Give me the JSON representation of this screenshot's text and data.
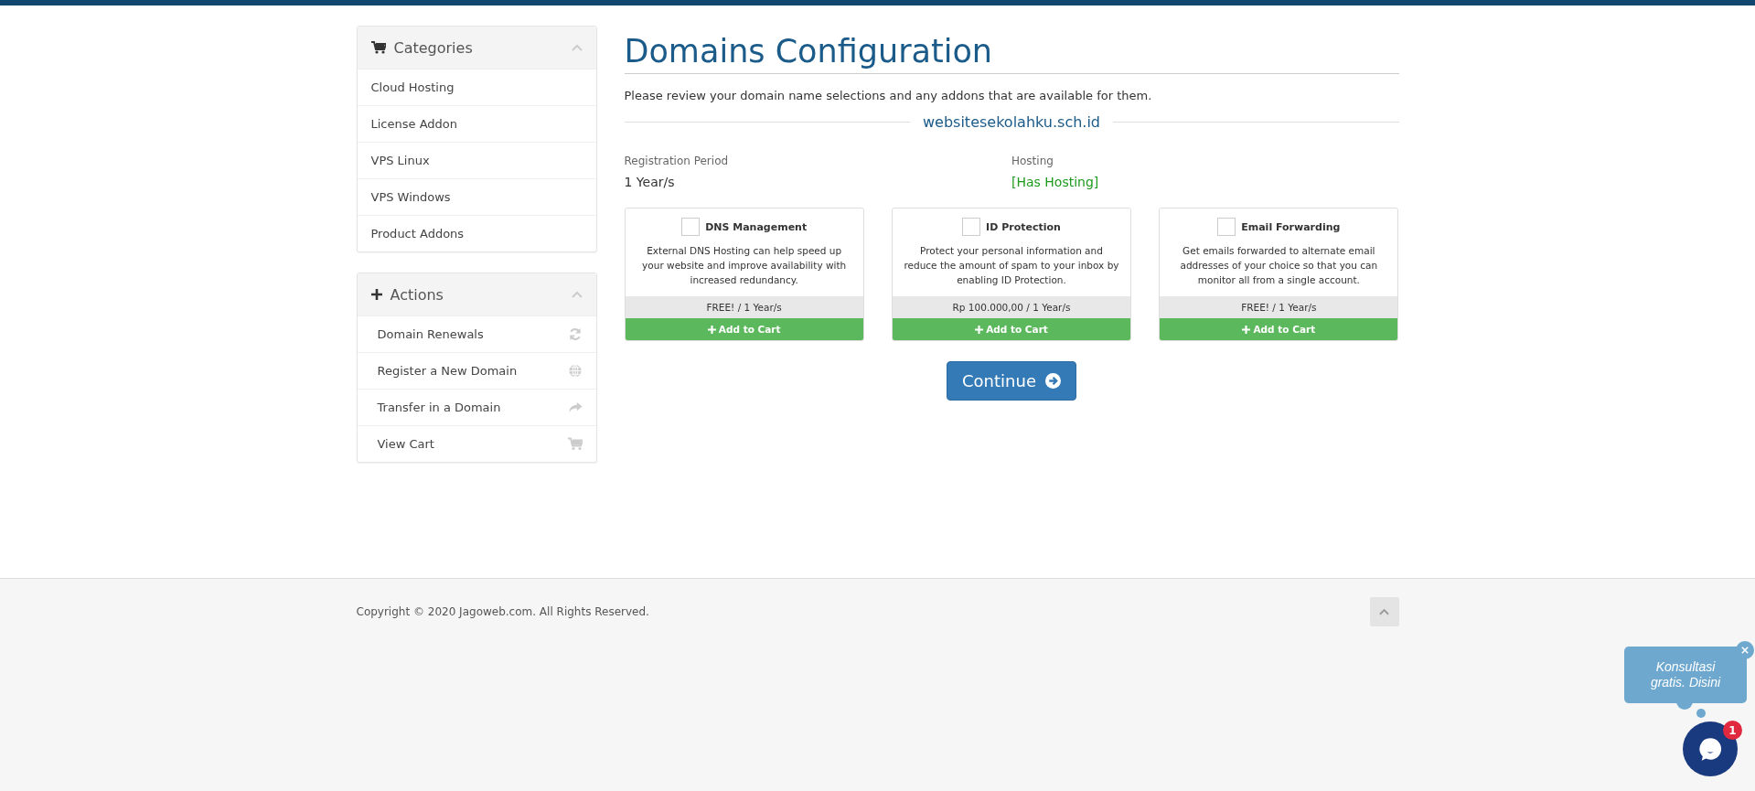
{
  "sidebar": {
    "categories": {
      "title": "Categories",
      "expanded": true,
      "items": [
        {
          "label": "Cloud Hosting"
        },
        {
          "label": "License Addon"
        },
        {
          "label": "VPS Linux"
        },
        {
          "label": "VPS Windows"
        },
        {
          "label": "Product Addons"
        }
      ]
    },
    "actions": {
      "title": "Actions",
      "expanded": true,
      "items": [
        {
          "label": "Domain Renewals",
          "kind": "refresh"
        },
        {
          "label": "Register a New Domain",
          "kind": "globe"
        },
        {
          "label": "Transfer in a Domain",
          "kind": "share"
        },
        {
          "label": "View Cart",
          "kind": "cart"
        }
      ]
    }
  },
  "main": {
    "title": "Domains Configuration",
    "intro": "Please review your domain name selections and any addons that are available for them.",
    "domain": "websitesekolahku.sch.id",
    "fields": [
      {
        "label": "Registration Period",
        "value": "1 Year/s",
        "kind": "plain"
      },
      {
        "label": "Hosting",
        "value": "[Has Hosting]",
        "kind": "status"
      }
    ],
    "addons": [
      {
        "name": "DNS Management",
        "checked": false,
        "description": "External DNS Hosting can help speed up your website and improve availability with increased redundancy.",
        "price": "FREE! / 1 Year/s",
        "button": "Add to Cart"
      },
      {
        "name": "ID Protection",
        "checked": false,
        "description": "Protect your personal information and reduce the amount of spam to your inbox by enabling ID Protection.",
        "price": "Rp 100.000,00 / 1 Year/s",
        "button": "Add to Cart"
      },
      {
        "name": "Email Forwarding",
        "checked": false,
        "description": "Get emails forwarded to alternate email addresses of your choice so that you can monitor all from a single account.",
        "price": "FREE! / 1 Year/s",
        "button": "Add to Cart"
      }
    ],
    "continue_button": "Continue"
  },
  "footer": {
    "copyright": "Copyright © 2020 Jagoweb.com. All Rights Reserved."
  },
  "chat": {
    "bubble": "Konsultasi gratis. Disini",
    "badge": "1"
  }
}
